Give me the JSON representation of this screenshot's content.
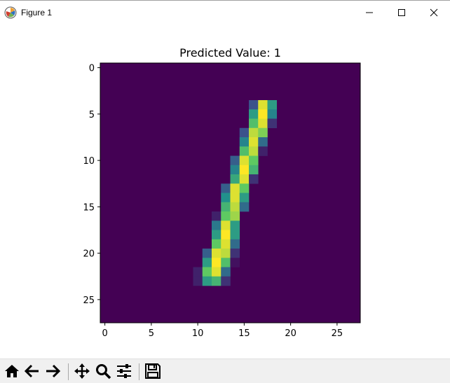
{
  "window": {
    "title": "Figure 1"
  },
  "titlebar_buttons": [
    {
      "name": "minimize-button",
      "icon": "minimize-icon"
    },
    {
      "name": "maximize-button",
      "icon": "maximize-icon"
    },
    {
      "name": "close-button",
      "icon": "close-icon"
    }
  ],
  "chart_data": {
    "type": "heatmap",
    "title": "Predicted Value: 1",
    "colormap": "viridis",
    "xlim": [
      -0.5,
      27.5
    ],
    "ylim": [
      27.5,
      -0.5
    ],
    "xticks": [
      0,
      5,
      10,
      15,
      20,
      25
    ],
    "yticks": [
      0,
      5,
      10,
      15,
      20,
      25
    ],
    "background_value": 0,
    "pixels": [
      [
        4,
        16,
        0.25
      ],
      [
        4,
        17,
        0.95
      ],
      [
        4,
        18,
        0.55
      ],
      [
        5,
        16,
        0.55
      ],
      [
        5,
        17,
        1.0
      ],
      [
        5,
        18,
        0.45
      ],
      [
        6,
        16,
        0.7
      ],
      [
        6,
        17,
        0.95
      ],
      [
        6,
        18,
        0.15
      ],
      [
        7,
        15,
        0.25
      ],
      [
        7,
        16,
        0.9
      ],
      [
        7,
        17,
        0.8
      ],
      [
        8,
        15,
        0.45
      ],
      [
        8,
        16,
        0.95
      ],
      [
        8,
        17,
        0.35
      ],
      [
        9,
        15,
        0.7
      ],
      [
        9,
        16,
        0.9
      ],
      [
        9,
        17,
        0.1
      ],
      [
        10,
        14,
        0.3
      ],
      [
        10,
        15,
        0.95
      ],
      [
        10,
        16,
        0.75
      ],
      [
        11,
        14,
        0.45
      ],
      [
        11,
        15,
        1.0
      ],
      [
        11,
        16,
        0.65
      ],
      [
        12,
        14,
        0.6
      ],
      [
        12,
        15,
        0.95
      ],
      [
        12,
        16,
        0.15
      ],
      [
        13,
        13,
        0.3
      ],
      [
        13,
        14,
        0.95
      ],
      [
        13,
        15,
        0.75
      ],
      [
        14,
        13,
        0.5
      ],
      [
        14,
        14,
        0.95
      ],
      [
        14,
        15,
        0.55
      ],
      [
        15,
        13,
        0.65
      ],
      [
        15,
        14,
        0.9
      ],
      [
        15,
        15,
        0.35
      ],
      [
        16,
        12,
        0.1
      ],
      [
        16,
        13,
        0.75
      ],
      [
        16,
        14,
        0.85
      ],
      [
        17,
        12,
        0.4
      ],
      [
        17,
        13,
        0.95
      ],
      [
        17,
        14,
        0.55
      ],
      [
        18,
        12,
        0.55
      ],
      [
        18,
        13,
        1.0
      ],
      [
        18,
        14,
        0.55
      ],
      [
        19,
        12,
        0.75
      ],
      [
        19,
        13,
        0.95
      ],
      [
        19,
        14,
        0.35
      ],
      [
        20,
        11,
        0.3
      ],
      [
        20,
        12,
        0.95
      ],
      [
        20,
        13,
        0.9
      ],
      [
        20,
        14,
        0.15
      ],
      [
        21,
        11,
        0.55
      ],
      [
        21,
        12,
        1.0
      ],
      [
        21,
        13,
        0.7
      ],
      [
        21,
        14,
        0.05
      ],
      [
        22,
        10,
        0.1
      ],
      [
        22,
        11,
        0.75
      ],
      [
        22,
        12,
        0.95
      ],
      [
        22,
        13,
        0.35
      ],
      [
        23,
        10,
        0.1
      ],
      [
        23,
        11,
        0.55
      ],
      [
        23,
        12,
        0.65
      ],
      [
        23,
        13,
        0.15
      ]
    ]
  },
  "toolbar": [
    {
      "name": "home-button",
      "icon": "home-icon"
    },
    {
      "name": "back-button",
      "icon": "arrow-left-icon"
    },
    {
      "name": "forward-button",
      "icon": "arrow-right-icon"
    },
    {
      "name": "pan-button",
      "icon": "move-icon"
    },
    {
      "name": "zoom-button",
      "icon": "magnifier-icon"
    },
    {
      "name": "configure-subplots-button",
      "icon": "sliders-icon"
    },
    {
      "name": "save-button",
      "icon": "floppy-disk-icon"
    }
  ]
}
